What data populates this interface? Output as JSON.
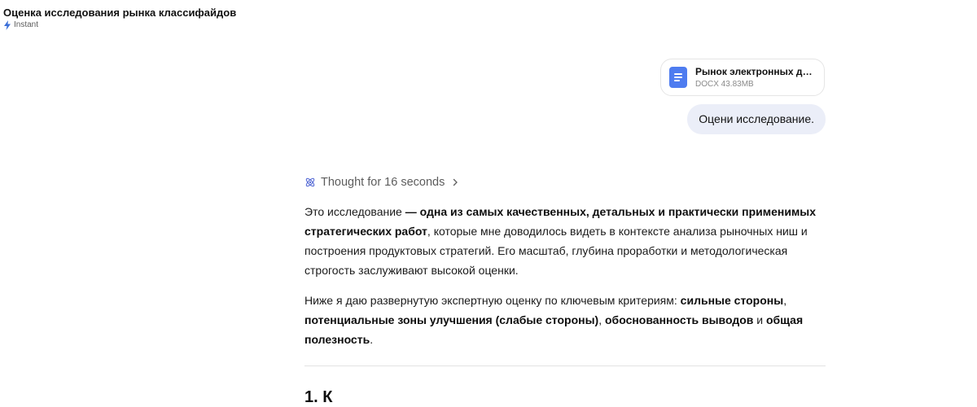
{
  "header": {
    "title": "Оценка исследования рынка классифайдов",
    "model": "Instant",
    "model_icon": "bolt-icon"
  },
  "attachment": {
    "file_name": "Рынок электронных документов.docx",
    "file_info": "DOCX 43.83MB",
    "icon": "document-icon",
    "icon_color": "#4e7cf0"
  },
  "user_message": {
    "text": "Оцени исследование."
  },
  "assistant": {
    "thought_label": "Thought for 16 seconds",
    "p1": {
      "t1": "Это исследование ",
      "b1": "— одна из самых качественных, детальных и практически применимых стратегических работ",
      "t2": ", которые мне доводилось видеть в контексте анализа рыночных ниш и построения продуктовых стратегий. Его масштаб, глубина проработки и методологическая строгость заслуживают высокой оценки."
    },
    "p2": {
      "t1": "Ниже я даю развернутую экспертную оценку по ключевым критериям: ",
      "b1": "сильные стороны",
      "t2": ", ",
      "b2": "потенциальные зоны улучшения (слабые стороны)",
      "t3": ", ",
      "b3": "обоснованность выводов",
      "t4": " и ",
      "b4": "общая полезность",
      "t5": "."
    },
    "section_heading": "1. К"
  },
  "colors": {
    "user_bubble": "#ebeef8",
    "accent": "#4e7cf0"
  }
}
